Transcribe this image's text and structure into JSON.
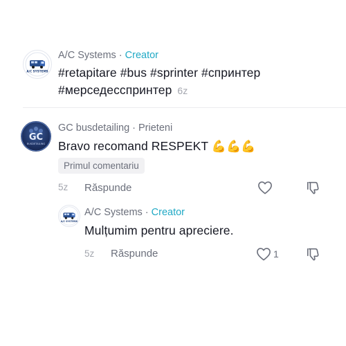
{
  "comments": [
    {
      "author": "A/C Systems",
      "role": "Creator",
      "text": "#retapitare #bus #sprinter #спринтер",
      "text_line2": "#мерседесспринтер",
      "time": "6z",
      "avatar_text": "A/C SYSTEMS"
    },
    {
      "author": "GC busdetailing",
      "role": "Prieteni",
      "text": "Bravo recomand RESPEKT",
      "emoji": "💪💪💪",
      "badge": "Primul comentariu",
      "time": "5z",
      "reply_label": "Răspunde",
      "avatar_text": "GC",
      "avatar_sub": "BUSDETAILING"
    },
    {
      "author": "A/C Systems",
      "role": "Creator",
      "text": "Mulțumim pentru apreciere.",
      "time": "5z",
      "reply_label": "Răspunde",
      "like_count": "1",
      "avatar_text": "A/C SYSTEMS"
    }
  ],
  "separator": "·",
  "colors": {
    "creator": "#20a9c5",
    "muted": "#6b6f7b",
    "text": "#161823"
  }
}
